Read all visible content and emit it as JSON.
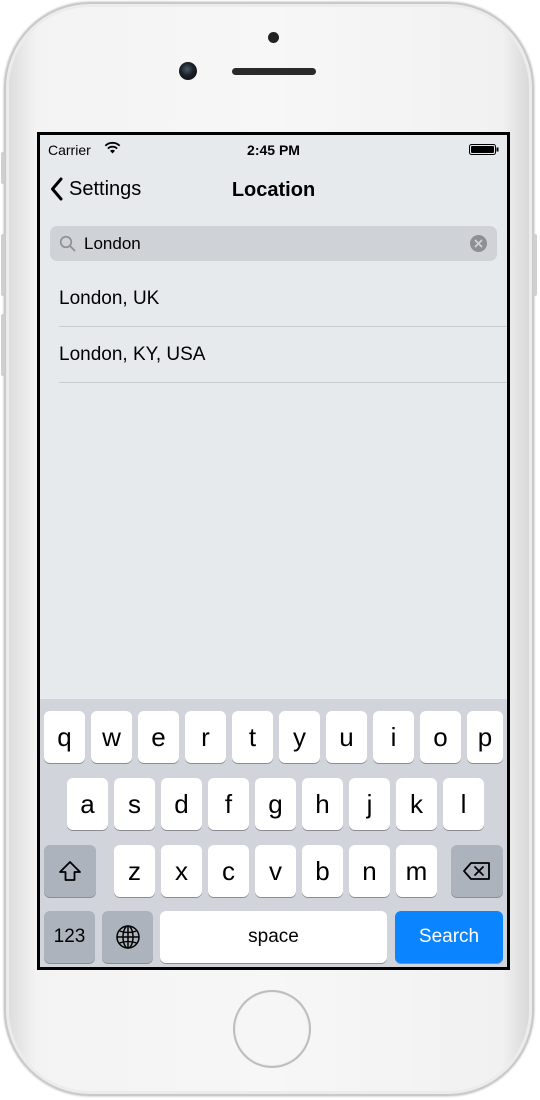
{
  "status_bar": {
    "carrier": "Carrier",
    "time": "2:45 PM",
    "wifi_icon": "wifi-icon",
    "battery_icon": "battery-icon"
  },
  "nav": {
    "back_label": "Settings",
    "back_icon": "chevron-left-icon",
    "title": "Location"
  },
  "search": {
    "value": "London",
    "search_icon": "search-icon",
    "clear_icon": "clear-icon"
  },
  "results": [
    {
      "label": "London, UK"
    },
    {
      "label": "London, KY, USA"
    }
  ],
  "keyboard": {
    "row1": [
      "q",
      "w",
      "e",
      "r",
      "t",
      "y",
      "u",
      "i",
      "o",
      "p"
    ],
    "row2": [
      "a",
      "s",
      "d",
      "f",
      "g",
      "h",
      "j",
      "k",
      "l"
    ],
    "row3": [
      "z",
      "x",
      "c",
      "v",
      "b",
      "n",
      "m"
    ],
    "shift_icon": "shift-icon",
    "delete_icon": "backspace-icon",
    "numbers_label": "123",
    "globe_icon": "globe-icon",
    "space_label": "space",
    "return_label": "Search"
  },
  "colors": {
    "accent": "#0a84ff",
    "screen_bg": "#e7eaed",
    "keyboard_bg": "#d1d5db"
  }
}
